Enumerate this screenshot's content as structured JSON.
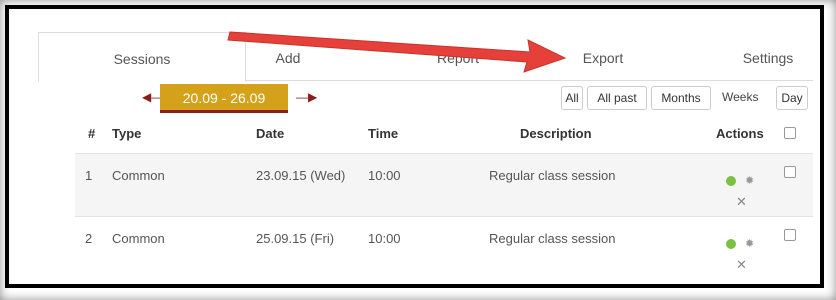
{
  "tabs": [
    {
      "label": "Sessions"
    },
    {
      "label": "Add"
    },
    {
      "label": "Report"
    },
    {
      "label": "Export"
    },
    {
      "label": "Settings"
    }
  ],
  "date_range": {
    "label": "20.09 - 26.09"
  },
  "views": {
    "all": "All",
    "all_past": "All past",
    "months": "Months",
    "weeks": "Weeks",
    "day": "Day"
  },
  "table": {
    "headers": {
      "num": "#",
      "type": "Type",
      "date": "Date",
      "time": "Time",
      "description": "Description",
      "actions": "Actions"
    },
    "rows": [
      {
        "num": "1",
        "type": "Common",
        "date": "23.09.15 (Wed)",
        "time": "10:00",
        "description": "Regular class session"
      },
      {
        "num": "2",
        "type": "Common",
        "date": "25.09.15 (Fri)",
        "time": "10:00",
        "description": "Regular class session"
      }
    ]
  },
  "colors": {
    "accent": "#d4a21a",
    "dark_red": "#8b1d1d",
    "status_green": "#7bc043",
    "annotation_arrow": "#e5413a"
  },
  "icons": {
    "prev": "left-arrow-icon",
    "next": "right-arrow-icon",
    "status": "green-dot-icon",
    "settings": "gear-icon",
    "delete": "close-icon"
  }
}
